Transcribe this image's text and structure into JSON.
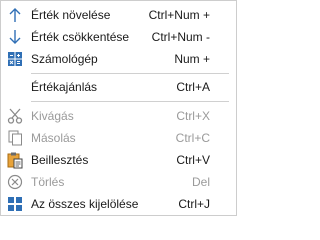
{
  "menu": {
    "items": [
      {
        "label": "Érték növelése",
        "shortcut": "Ctrl+Num +",
        "icon": "arrow-up-icon",
        "enabled": true
      },
      {
        "label": "Érték csökkentése",
        "shortcut": "Ctrl+Num -",
        "icon": "arrow-down-icon",
        "enabled": true
      },
      {
        "label": "Számológép",
        "shortcut": "Num +",
        "icon": "calculator-icon",
        "enabled": true
      },
      {
        "label": "Értékajánlás",
        "shortcut": "Ctrl+A",
        "icon": "",
        "enabled": true
      },
      {
        "label": "Kivágás",
        "shortcut": "Ctrl+X",
        "icon": "scissors-icon",
        "enabled": false
      },
      {
        "label": "Másolás",
        "shortcut": "Ctrl+C",
        "icon": "copy-icon",
        "enabled": false
      },
      {
        "label": "Beillesztés",
        "shortcut": "Ctrl+V",
        "icon": "paste-icon",
        "enabled": true
      },
      {
        "label": "Törlés",
        "shortcut": "Del",
        "icon": "delete-icon",
        "enabled": false
      },
      {
        "label": "Az összes kijelölése",
        "shortcut": "Ctrl+J",
        "icon": "select-all-icon",
        "enabled": true
      }
    ]
  },
  "colors": {
    "icon_blue": "#2f6fb5",
    "disabled_gray": "#9a9a9a",
    "paste_orange": "#e8a33a"
  }
}
